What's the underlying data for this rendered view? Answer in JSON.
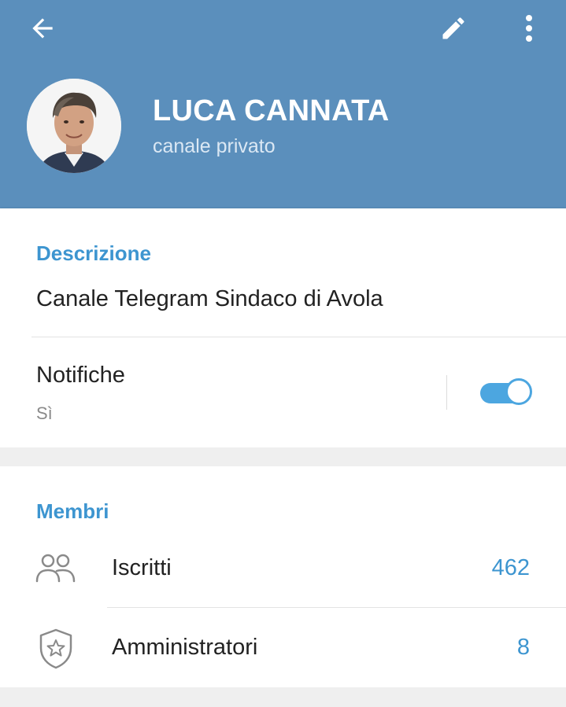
{
  "header": {
    "title": "LUCA CANNATA",
    "subtitle": "canale privato",
    "back_icon": "arrow-left-icon",
    "edit_icon": "pencil-icon",
    "more_icon": "more-vert-icon",
    "background_color": "#5b8fbc"
  },
  "description_section": {
    "title": "Descrizione",
    "text": "Canale Telegram Sindaco di Avola"
  },
  "notifications": {
    "label": "Notifiche",
    "status": "Sì",
    "enabled": true
  },
  "members_section": {
    "title": "Membri",
    "rows": [
      {
        "icon": "people-icon",
        "label": "Iscritti",
        "value": "462"
      },
      {
        "icon": "shield-star-icon",
        "label": "Amministratori",
        "value": "8"
      }
    ]
  },
  "colors": {
    "accent": "#3d95d0",
    "toggle": "#4ca6e0"
  }
}
